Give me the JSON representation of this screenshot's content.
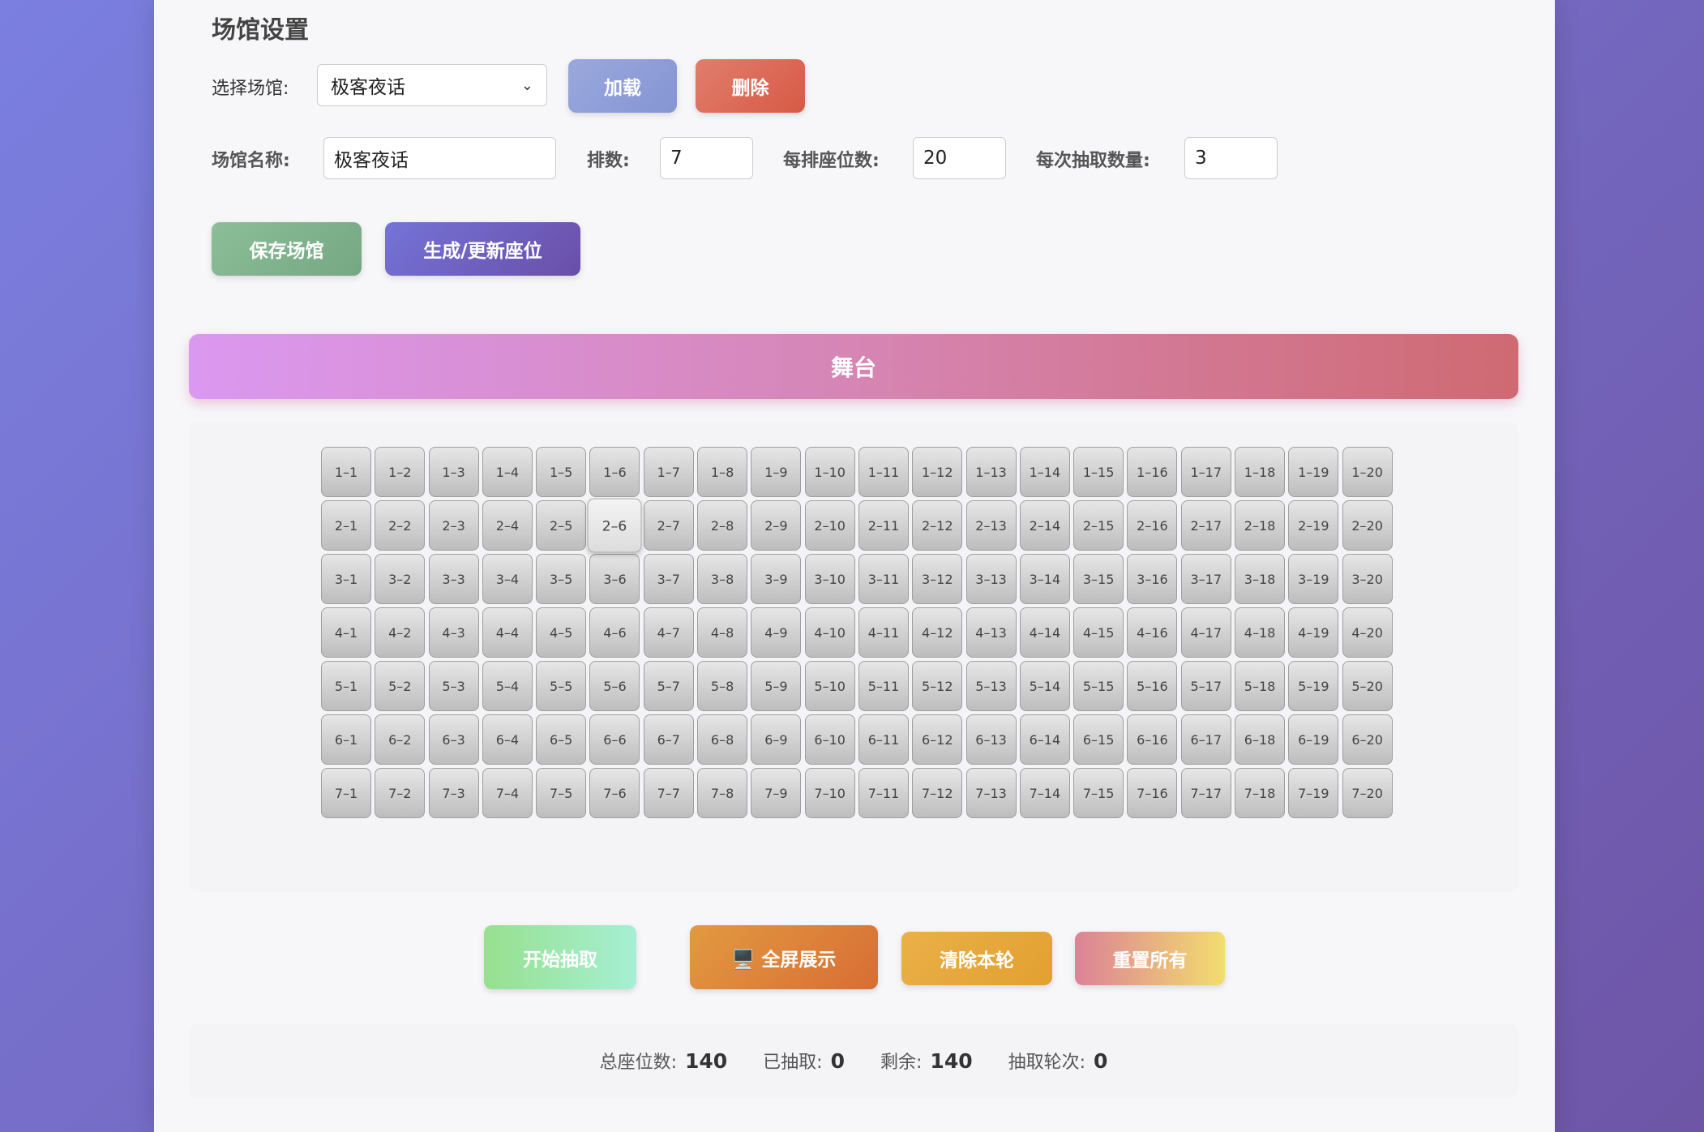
{
  "settings": {
    "title": "场馆设置",
    "select_label": "选择场馆:",
    "selected_venue": "极客夜话",
    "load_button": "加载",
    "delete_button": "删除",
    "name_label": "场馆名称:",
    "name_value": "极客夜话",
    "rows_label": "排数:",
    "rows_value": "7",
    "seats_per_row_label": "每排座位数:",
    "seats_per_row_value": "20",
    "draw_count_label": "每次抽取数量:",
    "draw_count_value": "3",
    "save_button": "保存场馆",
    "generate_button": "生成/更新座位"
  },
  "stage": {
    "label": "舞台"
  },
  "seating": {
    "rows": 7,
    "cols": 20,
    "hovered_seat": "2-6"
  },
  "actions": {
    "start_button": "开始抽取",
    "fullscreen_icon": "monitor-icon",
    "fullscreen_button": "🖥️ 全屏展示",
    "clear_button": "清除本轮",
    "reset_button": "重置所有"
  },
  "stats": {
    "total_label": "总座位数:",
    "total_value": "140",
    "drawn_label": "已抽取:",
    "drawn_value": "0",
    "remaining_label": "剩余:",
    "remaining_value": "140",
    "rounds_label": "抽取轮次:",
    "rounds_value": "0"
  },
  "colors": {
    "load": "#8c9ad8",
    "delete": "#dc6a58",
    "save": "#7fb08c",
    "generate": "#6a5dc0",
    "start_from": "#97e08e",
    "start_to": "#a6efd4",
    "fullscreen": "#df7e3a",
    "clear": "#e6a63a",
    "reset_from": "#dc8296",
    "reset_to": "#f2dd6e"
  }
}
